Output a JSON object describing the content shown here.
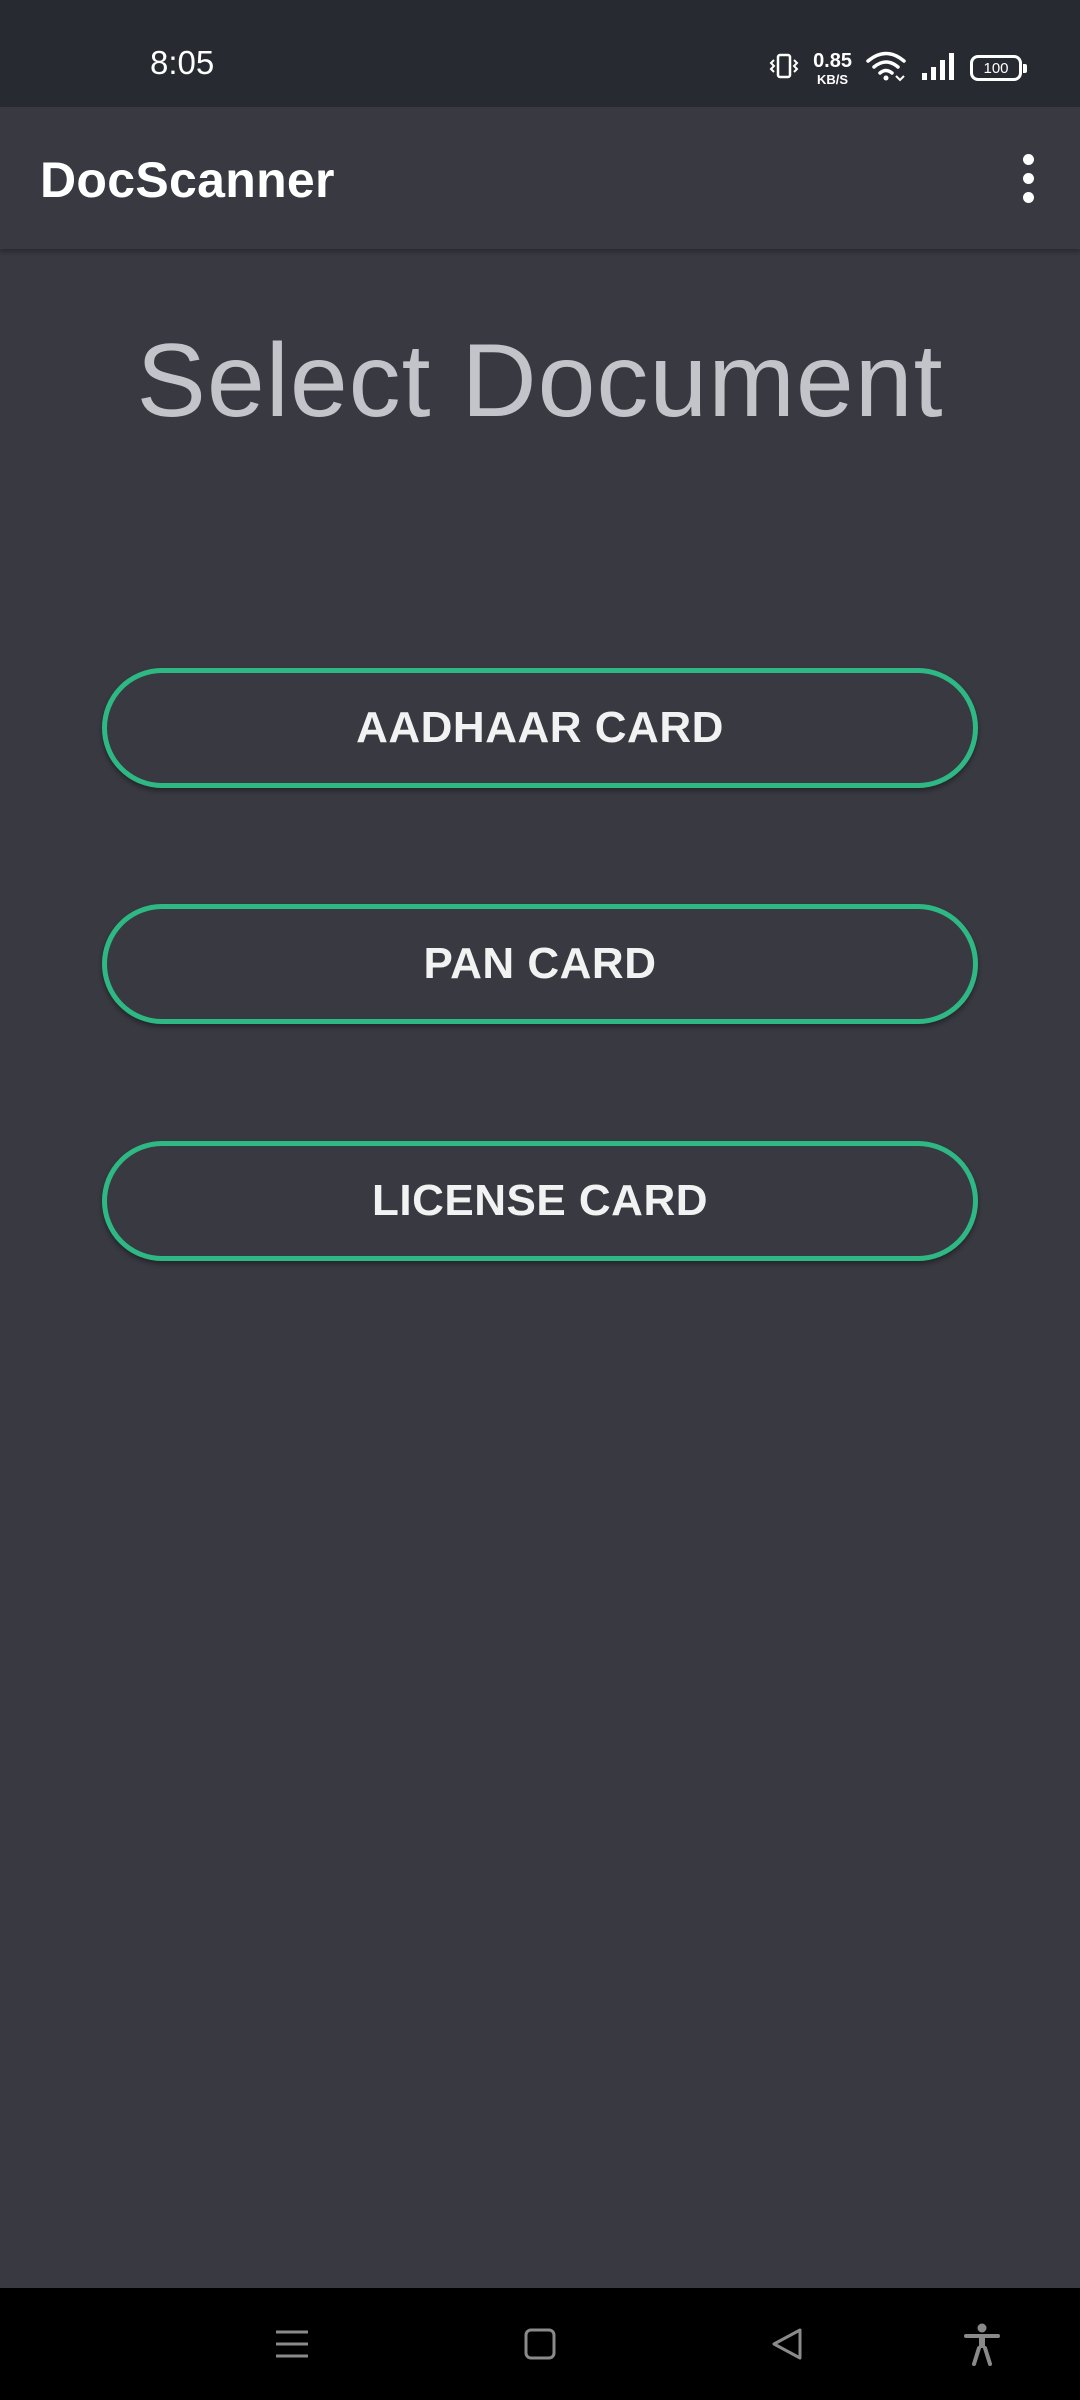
{
  "status_bar": {
    "time": "8:05",
    "net_speed_value": "0.85",
    "net_speed_unit": "KB/S",
    "battery_level": "100",
    "icons": [
      "vibrate-icon",
      "wifi-icon",
      "cellular-signal-icon",
      "battery-icon"
    ]
  },
  "app_bar": {
    "title": "DocScanner",
    "menu_icon": "more-vert-icon"
  },
  "main": {
    "heading": "Select Document",
    "buttons": [
      {
        "label": "AADHAAR CARD"
      },
      {
        "label": "PAN CARD"
      },
      {
        "label": "LICENSE CARD"
      }
    ]
  },
  "nav_bar": {
    "icons": [
      "menu-icon",
      "home-icon",
      "back-icon",
      "accessibility-icon"
    ]
  },
  "colors": {
    "background": "#383941",
    "status_bar": "#282a31",
    "accent": "#2eb884",
    "heading_text": "#c3c3ca",
    "button_text": "#f2f2f2"
  }
}
